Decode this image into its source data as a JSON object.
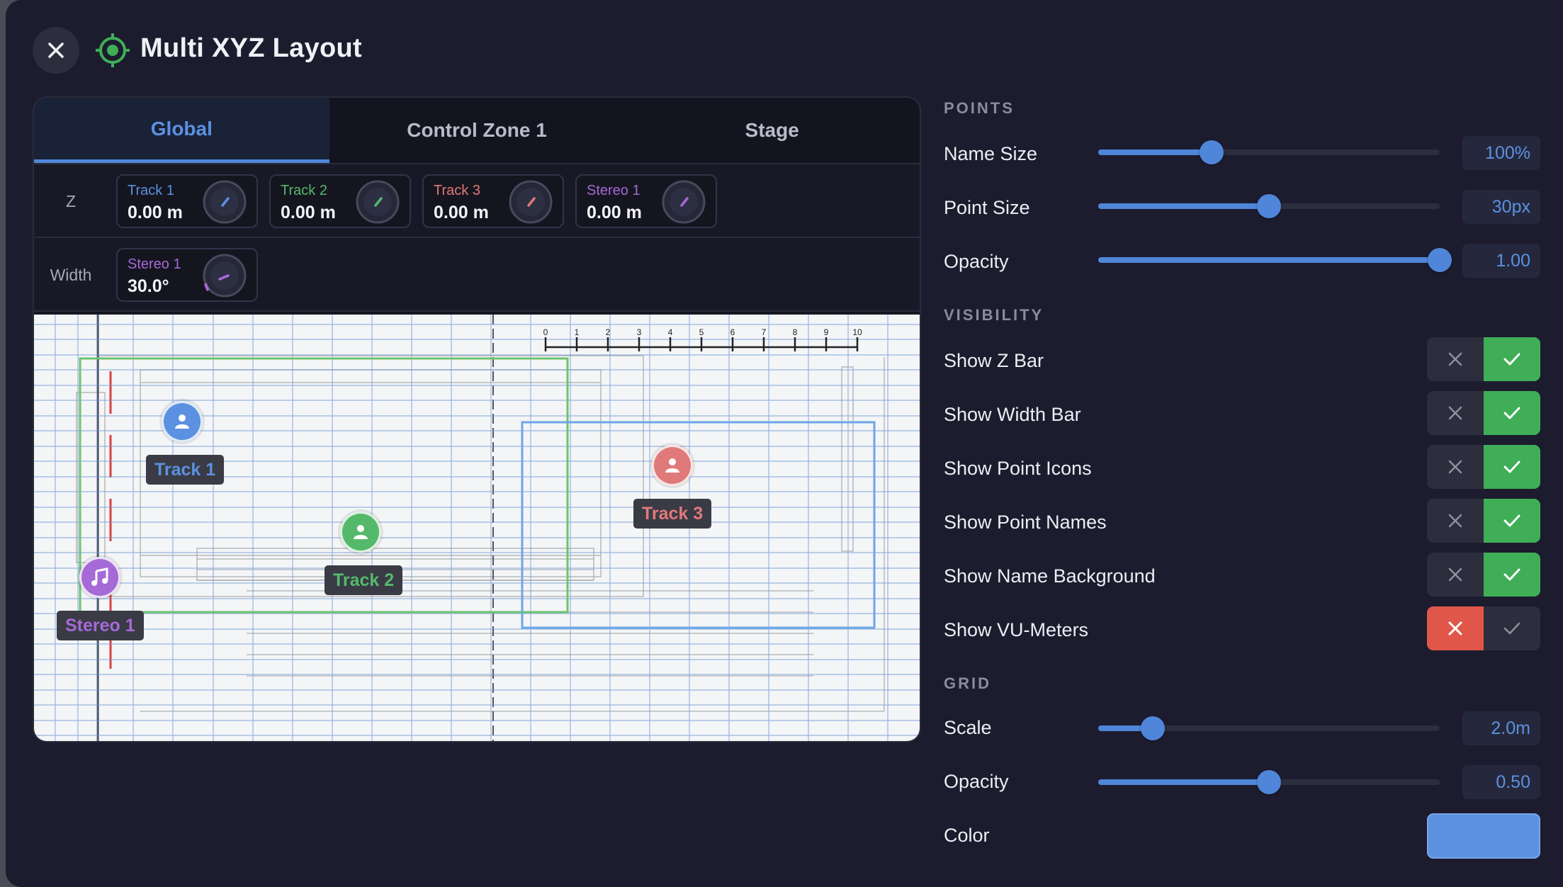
{
  "window": {
    "title": "Multi XYZ Layout"
  },
  "tabs": [
    {
      "label": "Global",
      "active": true
    },
    {
      "label": "Control Zone 1",
      "active": false
    },
    {
      "label": "Stage",
      "active": false
    }
  ],
  "z_row": {
    "label": "Z",
    "channels": [
      {
        "name": "Track 1",
        "value": "0.00 m",
        "color": "#5b91e0"
      },
      {
        "name": "Track 2",
        "value": "0.00 m",
        "color": "#55b96b"
      },
      {
        "name": "Track 3",
        "value": "0.00 m",
        "color": "#e07a7a"
      },
      {
        "name": "Stereo 1",
        "value": "0.00 m",
        "color": "#a56ad6"
      }
    ]
  },
  "width_row": {
    "label": "Width",
    "channels": [
      {
        "name": "Stereo 1",
        "value": "30.0°",
        "color": "#a56ad6"
      }
    ]
  },
  "canvas": {
    "scale_ticks": [
      "0",
      "1",
      "2",
      "3",
      "4",
      "5",
      "6",
      "7",
      "8",
      "9",
      "10"
    ],
    "points": [
      {
        "name": "Track 1",
        "icon": "person-icon",
        "color": "#5b91e0"
      },
      {
        "name": "Track 2",
        "icon": "person-icon",
        "color": "#55b96b"
      },
      {
        "name": "Track 3",
        "icon": "person-icon",
        "color": "#e07a7a"
      },
      {
        "name": "Stereo 1",
        "icon": "music-note-icon",
        "color": "#a56ad6"
      }
    ]
  },
  "settings": {
    "points": {
      "title": "POINTS",
      "name_size": {
        "label": "Name Size",
        "value": "100%",
        "fraction": 0.33
      },
      "point_size": {
        "label": "Point Size",
        "value": "30px",
        "fraction": 0.5
      },
      "opacity": {
        "label": "Opacity",
        "value": "1.00",
        "fraction": 1.0
      }
    },
    "visibility": {
      "title": "VISIBILITY",
      "items": [
        {
          "label": "Show Z Bar",
          "enabled": true
        },
        {
          "label": "Show Width Bar",
          "enabled": true
        },
        {
          "label": "Show Point Icons",
          "enabled": true
        },
        {
          "label": "Show Point Names",
          "enabled": true
        },
        {
          "label": "Show Name Background",
          "enabled": true
        },
        {
          "label": "Show VU-Meters",
          "enabled": false
        }
      ]
    },
    "grid": {
      "title": "GRID",
      "scale": {
        "label": "Scale",
        "value": "2.0m",
        "fraction": 0.16
      },
      "opacity": {
        "label": "Opacity",
        "value": "0.50",
        "fraction": 0.5
      },
      "color": {
        "label": "Color",
        "value": "#5b91e0"
      }
    }
  }
}
